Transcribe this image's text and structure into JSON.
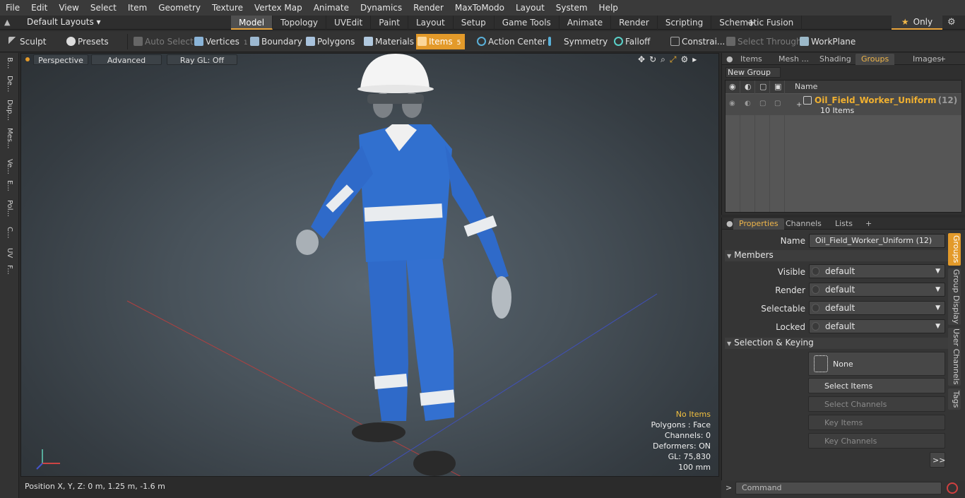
{
  "menu": [
    "File",
    "Edit",
    "View",
    "Select",
    "Item",
    "Geometry",
    "Texture",
    "Vertex Map",
    "Animate",
    "Dynamics",
    "Render",
    "MaxToModo",
    "Layout",
    "System",
    "Help"
  ],
  "layout_bar": {
    "layouts_label": "Default Layouts",
    "tabs": [
      "Model",
      "Topology",
      "UVEdit",
      "Paint",
      "Layout",
      "Setup",
      "Game Tools",
      "Animate",
      "Render",
      "Scripting",
      "Schematic Fusion"
    ],
    "active_tab": "Model",
    "plus": "+",
    "only_label": "Only",
    "star": "★",
    "gear": "⚙"
  },
  "toolbar": {
    "sculpt": "Sculpt",
    "presets": "Presets",
    "auto_select": "Auto Select",
    "vertices": "Vertices",
    "vertices_count": "1",
    "boundary": "Boundary",
    "polygons": "Polygons",
    "materials": "Materials",
    "items": "Items",
    "items_count": "5",
    "action_center": "Action Center",
    "symmetry": "Symmetry",
    "falloff": "Falloff",
    "constraints": "Constrai...",
    "select_through": "Select Through",
    "workplane": "WorkPlane"
  },
  "left_strip": [
    "B...",
    "De...",
    "Dup...",
    "Mes...",
    "Ve...",
    "E...",
    "Pol...",
    "C...",
    "UV",
    "F..."
  ],
  "viewport": {
    "perspective": "Perspective",
    "advanced": "Advanced",
    "ray_gl": "Ray GL: Off",
    "icons": [
      "✥",
      "↻",
      "⌕",
      "⤢",
      "⚙",
      "▸"
    ],
    "info": {
      "no_items": "No Items",
      "polygons": "Polygons : Face",
      "channels": "Channels: 0",
      "deformers": "Deformers: ON",
      "gl": "GL: 75,830",
      "scale": "100 mm"
    },
    "position": "Position X, Y, Z:   0 m, 1.25 m, -1.6 m"
  },
  "groups_panel": {
    "tabs": [
      "Items",
      "Mesh ...",
      "Shading",
      "Groups",
      "Images"
    ],
    "active_tab": "Groups",
    "new_group": "New Group",
    "column_name": "Name",
    "group_name": "Oil_Field_Worker_Uniform",
    "group_count": "(12)",
    "group_sub": "10 Items"
  },
  "properties_panel": {
    "tabs": [
      "Properties",
      "Channels",
      "Lists"
    ],
    "active_tab": "Properties",
    "name_label": "Name",
    "name_value": "Oil_Field_Worker_Uniform (12)",
    "members_section": "Members",
    "visible_label": "Visible",
    "render_label": "Render",
    "selectable_label": "Selectable",
    "locked_label": "Locked",
    "default_value": "default",
    "selection_section": "Selection & Keying",
    "none_button": "None",
    "select_items": "Select Items",
    "select_channels": "Select Channels",
    "key_items": "Key Items",
    "key_channels": "Key Channels",
    "more": ">>",
    "side_tabs": [
      "Groups",
      "Group Display",
      "User Channels",
      "Tags"
    ]
  },
  "command": {
    "placeholder": "Command",
    "prompt": ">"
  }
}
